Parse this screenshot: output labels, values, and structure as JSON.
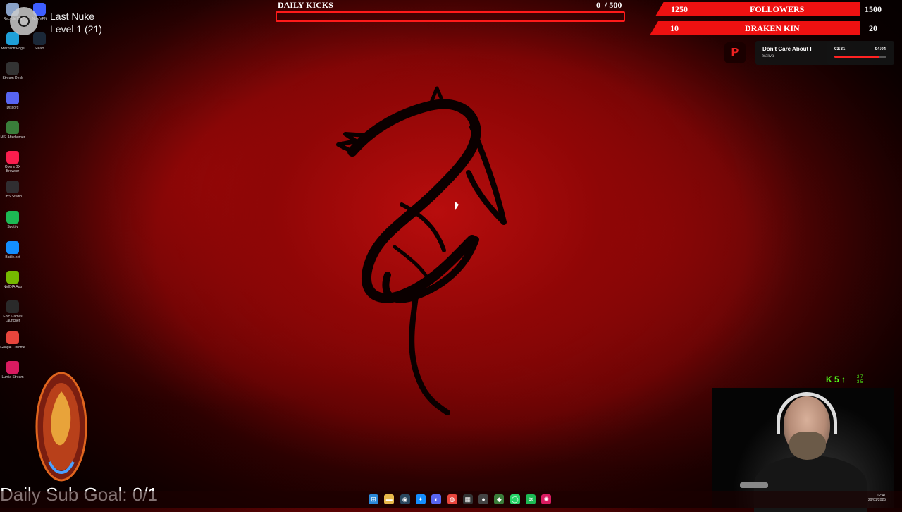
{
  "desktop_icons": [
    {
      "label": "Recycle Bin",
      "icon": "recycle-bin-icon",
      "color": "#8aa2c8"
    },
    {
      "label": "NordVPN",
      "icon": "nordvpn-icon",
      "color": "#3e5fff"
    },
    {
      "label": "Microsoft Edge",
      "icon": "edge-icon",
      "color": "#1fa0d8"
    },
    {
      "label": "Steam",
      "icon": "steam-icon",
      "color": "#1b2838"
    },
    {
      "label": "Stream Deck",
      "icon": "stream-deck-icon",
      "color": "#333333"
    },
    {
      "label": "Discord",
      "icon": "discord-icon",
      "color": "#5865f2"
    },
    {
      "label": "MSI Afterburner",
      "icon": "afterburner-icon",
      "color": "#3a7d3a"
    },
    {
      "label": "Opera GX Browser",
      "icon": "opera-gx-icon",
      "color": "#fa1e4e"
    },
    {
      "label": "OBS Studio",
      "icon": "obs-icon",
      "color": "#302e31"
    },
    {
      "label": "Spotify",
      "icon": "spotify-icon",
      "color": "#1db954"
    },
    {
      "label": "Battle.net",
      "icon": "battlenet-icon",
      "color": "#148eff"
    },
    {
      "label": "NVIDIA App",
      "icon": "nvidia-icon",
      "color": "#76b900"
    },
    {
      "label": "Epic Games Launcher",
      "icon": "epic-icon",
      "color": "#2a2a2a"
    },
    {
      "label": "Google Chrome",
      "icon": "chrome-icon",
      "color": "#e8453c"
    },
    {
      "label": "Lumia Stream",
      "icon": "lumia-icon",
      "color": "#d81b60"
    }
  ],
  "nuke": {
    "title": "Last Nuke",
    "level": "Level 1 (21)"
  },
  "daily_kicks": {
    "label": "DAILY KICKS",
    "current": "0",
    "target": "/ 500",
    "progress": 0
  },
  "goals": {
    "followers": {
      "current": "1250",
      "label": "FOLLOWERS",
      "target": "1500"
    },
    "draken_kin": {
      "current": "10",
      "label": "DRAKEN KIN",
      "target": "20"
    }
  },
  "music": {
    "logo": "P",
    "title": "Don't Care About I",
    "artist": "Saliva",
    "time_current": "03:31",
    "time_total": "04:04",
    "progress": 0.86
  },
  "sub_goal": "Daily Sub Goal: 0/1",
  "kick_stats": {
    "value": "5",
    "small_top": "2 7",
    "small_bottom": "3 5"
  },
  "taskbar_icons": [
    {
      "name": "start-icon",
      "glyph": "⊞",
      "color": "#2b88d8"
    },
    {
      "name": "file-explorer-icon",
      "glyph": "▬",
      "color": "#e8b84a"
    },
    {
      "name": "steam-taskbar-icon",
      "glyph": "◉",
      "color": "#2a475e"
    },
    {
      "name": "battlenet-taskbar-icon",
      "glyph": "✦",
      "color": "#148eff"
    },
    {
      "name": "discord-taskbar-icon",
      "glyph": "◐",
      "color": "#5865f2"
    },
    {
      "name": "chrome-taskbar-icon",
      "glyph": "◍",
      "color": "#e8453c"
    },
    {
      "name": "stream-deck-taskbar-icon",
      "glyph": "▦",
      "color": "#333333"
    },
    {
      "name": "obs-taskbar-icon",
      "glyph": "●",
      "color": "#444444"
    },
    {
      "name": "afterburner-taskbar-icon",
      "glyph": "◆",
      "color": "#3a7d3a"
    },
    {
      "name": "whatsapp-taskbar-icon",
      "glyph": "◯",
      "color": "#25d366"
    },
    {
      "name": "spotify-taskbar-icon",
      "glyph": "≋",
      "color": "#1db954"
    },
    {
      "name": "lumia-taskbar-icon",
      "glyph": "✺",
      "color": "#d81b60"
    }
  ],
  "tray": {
    "time": "12:41",
    "date": "29/01/2025"
  },
  "colors": {
    "accent_red": "#ee1111",
    "kick_green": "#53fc18"
  }
}
